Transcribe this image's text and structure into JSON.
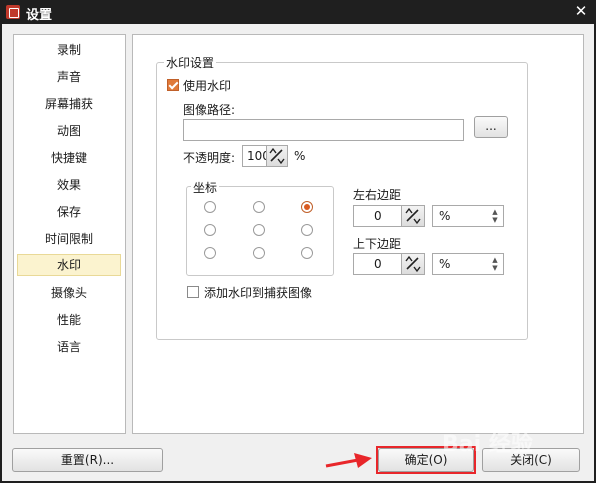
{
  "window": {
    "title": "设置"
  },
  "sidebar": {
    "items": [
      {
        "label": "录制"
      },
      {
        "label": "声音"
      },
      {
        "label": "屏幕捕获"
      },
      {
        "label": "动图"
      },
      {
        "label": "快捷键"
      },
      {
        "label": "效果"
      },
      {
        "label": "保存"
      },
      {
        "label": "时间限制"
      },
      {
        "label": "水印",
        "selected": true
      },
      {
        "label": "摄像头"
      },
      {
        "label": "性能"
      },
      {
        "label": "语言"
      }
    ]
  },
  "watermark_settings": {
    "group_label": "水印设置",
    "use_watermark_label": "使用水印",
    "use_watermark_checked": true,
    "image_path_label": "图像路径:",
    "image_path_value": "",
    "browse_button": "...",
    "opacity_label": "不透明度:",
    "opacity_value": "100",
    "opacity_unit": "%",
    "coord_label": "坐标",
    "coord_selected": "top-right",
    "lr_margin_label": "左右边距",
    "lr_margin_value": "0",
    "lr_margin_unit": "%",
    "tb_margin_label": "上下边距",
    "tb_margin_value": "0",
    "tb_margin_unit": "%",
    "add_to_capture_label": "添加水印到捕获图像",
    "add_to_capture_checked": false
  },
  "footer": {
    "reset_button": "重置(R)...",
    "ok_button": "确定(O)",
    "close_button": "关闭(C)"
  },
  "overlay": {
    "watermark_text": "Bai 经验"
  }
}
